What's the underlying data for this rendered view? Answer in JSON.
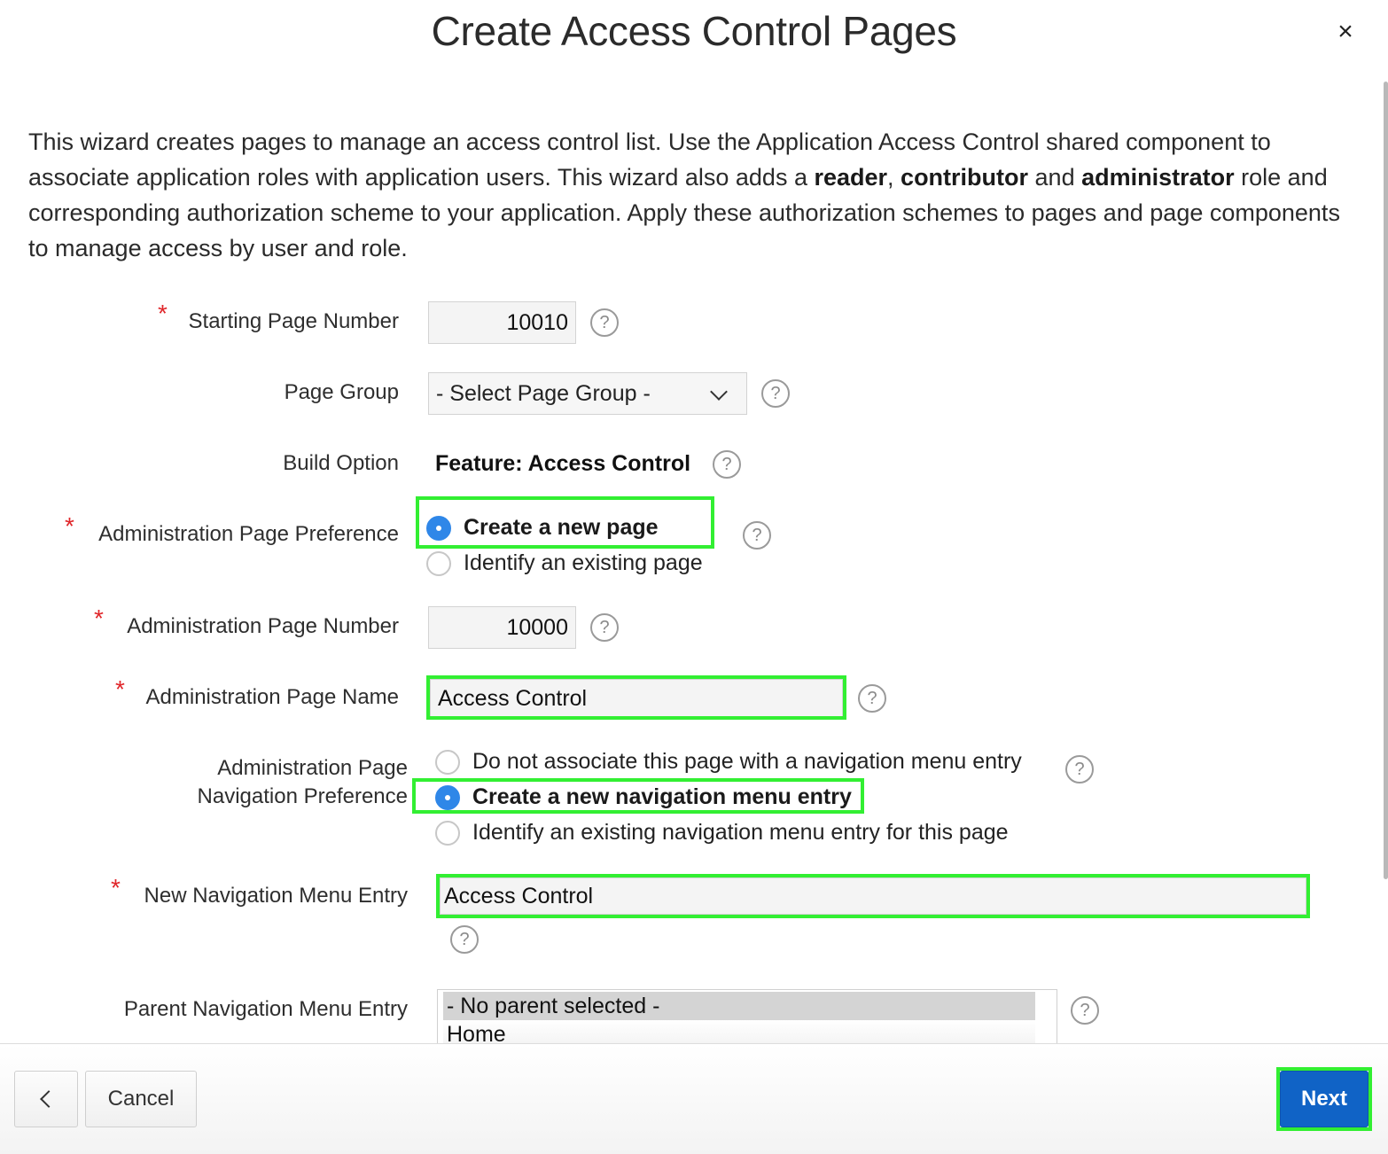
{
  "dialog": {
    "title": "Create Access Control Pages",
    "close_glyph": "×"
  },
  "intro": {
    "part1": "This wizard creates pages to manage an access control list. Use the Application Access Control shared component to associate application roles with application users. This wizard also adds a ",
    "reader": "reader",
    "comma": ", ",
    "contributor": "contributor",
    "and": " and ",
    "administrator": "administrator",
    "part2": " role and corresponding authorization scheme to your application. Apply these authorization schemes to pages and page components to manage access by user and role."
  },
  "required_marker": "*",
  "help_glyph": "?",
  "form": {
    "starting_page_number": {
      "label": "Starting Page Number",
      "value": "10010"
    },
    "page_group": {
      "label": "Page Group",
      "value": "- Select Page Group -"
    },
    "build_option": {
      "label": "Build Option",
      "value": "Feature: Access Control"
    },
    "admin_page_preference": {
      "label": "Administration Page Preference",
      "options": [
        "Create a new page",
        "Identify an existing page"
      ],
      "selected": 0
    },
    "admin_page_number": {
      "label": "Administration Page Number",
      "value": "10000"
    },
    "admin_page_name": {
      "label": "Administration Page Name",
      "value": "Access Control"
    },
    "admin_nav_preference": {
      "label_line1": "Administration Page",
      "label_line2": "Navigation Preference",
      "options": [
        "Do not associate this page with a navigation menu entry",
        "Create a new navigation menu entry",
        "Identify an existing navigation menu entry for this page"
      ],
      "selected": 1
    },
    "new_nav_menu_entry": {
      "label": "New Navigation Menu Entry",
      "value": "Access Control"
    },
    "parent_nav_menu_entry": {
      "label": "Parent Navigation Menu Entry",
      "options": [
        "- No parent selected -",
        "Home"
      ],
      "selected": 0
    }
  },
  "footer": {
    "cancel_label": "Cancel",
    "next_label": "Next"
  },
  "colors": {
    "highlight": "#32ef32",
    "primary_button": "#1063c6",
    "radio_selected": "#2f87e8",
    "required": "#e0262a"
  }
}
